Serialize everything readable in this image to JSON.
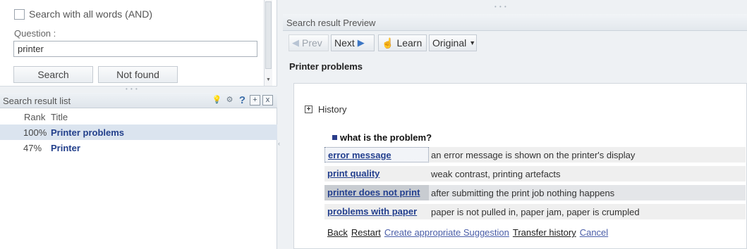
{
  "search": {
    "all_words_label": "Search with all words (AND)",
    "question_label": "Question :",
    "question_value": "printer",
    "search_button": "Search",
    "not_found_button": "Not found"
  },
  "result_list": {
    "title": "Search result list",
    "columns": {
      "rank": "Rank",
      "title": "Title"
    },
    "rows": [
      {
        "rank": "100%",
        "title": "Printer problems",
        "selected": true
      },
      {
        "rank": "47%",
        "title": "Printer",
        "selected": false
      }
    ],
    "icons": [
      "bulb-icon",
      "gear-icon",
      "help-icon",
      "add-icon",
      "close-icon"
    ],
    "icon_glyphs": {
      "add": "+",
      "close": "x",
      "help": "?"
    }
  },
  "preview": {
    "header": "Search result Preview",
    "toolbar": {
      "prev": "Prev",
      "next": "Next",
      "learn": "Learn",
      "original": "Original"
    },
    "document_title": "Printer problems",
    "history_label": "History",
    "question": "what is the problem?",
    "options": [
      {
        "link": "error message",
        "description": "an error message is shown on the printer's display"
      },
      {
        "link": "print quality",
        "description": "weak contrast, printing artefacts"
      },
      {
        "link": "printer does not print",
        "description": "after submitting the print job nothing happens"
      },
      {
        "link": "problems with paper",
        "description": "paper is not pulled in, paper jam, paper is crumpled"
      }
    ],
    "footer_links": {
      "back": "Back",
      "restart": "Restart",
      "create_suggestion": "Create appropriate Suggestion",
      "transfer_history": "Transfer history",
      "cancel": "Cancel"
    }
  },
  "colors": {
    "link_blue": "#233f8e",
    "selection": "#dbe4ef",
    "panel_bg": "#eef1f4"
  }
}
